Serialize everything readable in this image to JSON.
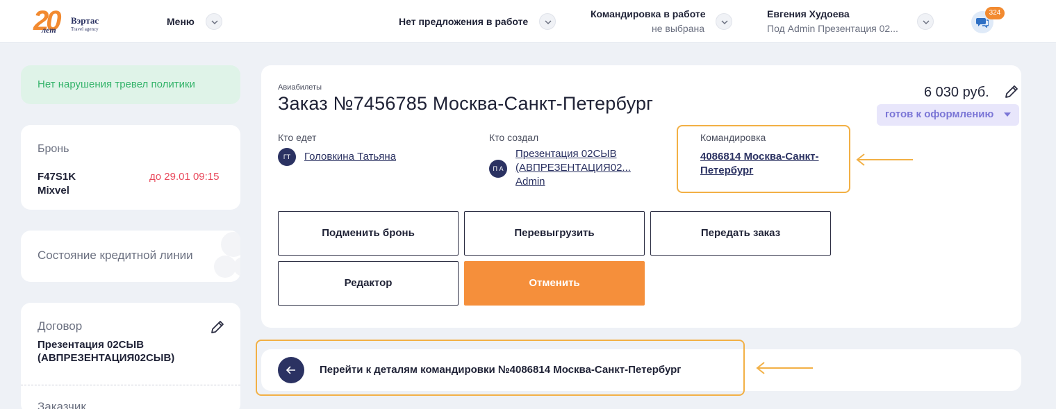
{
  "header": {
    "logo_number": "20",
    "logo_brand": "Вэртас",
    "logo_sub": "Travel agency",
    "logo_script": "лет",
    "menu_label": "Меню",
    "offer_label": "Нет предложения в работе",
    "trip_label": "Командировка в работе",
    "trip_value": "не выбрана",
    "user_name": "Евгения Худоева",
    "user_sub": "Под Admin Презентация 02...",
    "chat_count": "324"
  },
  "sidebar": {
    "policy_text": "Нет нарушения тревел политики",
    "booking_label": "Бронь",
    "booking_code": "F47S1K",
    "booking_system": "Mixvel",
    "booking_deadline": "до 29.01 09:15",
    "credit_label": "Состояние кредитной линии",
    "contract_label": "Договор",
    "contract_value_1": "Презентация 02СЫВ",
    "contract_value_2": "(АВПРЕЗЕНТАЦИЯ02СЫВ)",
    "customer_label": "Заказчик"
  },
  "order": {
    "category": "Авиабилеты",
    "title": "Заказ №7456785 Москва-Санкт-Петербург",
    "price": "6 030 руб.",
    "status": "готов к оформлению",
    "traveler_label": "Кто едет",
    "traveler_initials": "ГТ",
    "traveler_name": "Головкина Татьяна",
    "creator_label": "Кто создал",
    "creator_initials": "П А",
    "creator_line1": "Презентация 02СЫВ",
    "creator_line2": "(АВПРЕЗЕНТАЦИЯ02...",
    "creator_line3": "Admin",
    "trip_label": "Командировка",
    "trip_link_1": "4086814 Москва-Санкт-",
    "trip_link_2": "Петербург"
  },
  "actions": {
    "replace_booking": "Подменить бронь",
    "reupload": "Перевыгрузить",
    "transfer_order": "Передать заказ",
    "editor": "Редактор",
    "cancel": "Отменить"
  },
  "goto_trip": {
    "label": "Перейти к деталям командировки №4086814 Москва-Санкт-Петербург"
  },
  "colors": {
    "accent_orange": "#f58f3b",
    "highlight_border": "#f2b045",
    "navy": "#2b3262",
    "policy_green": "#34b36a",
    "deadline_red": "#e9485b",
    "status_purple": "#7b76d6"
  },
  "icons": {
    "menu_chevron": "chevron-down-icon",
    "chat": "chat-icon",
    "edit": "pencil-icon",
    "back": "arrow-left-icon",
    "pointer": "arrow-pointer-icon"
  }
}
